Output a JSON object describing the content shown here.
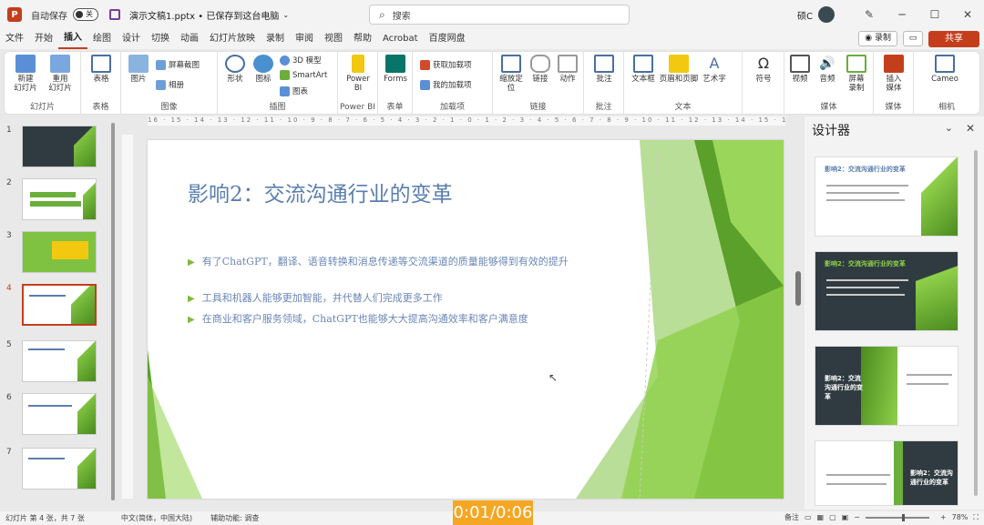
{
  "titlebar": {
    "autosave_label": "自动保存",
    "autosave_state": "关",
    "file_title": "演示文稿1.pptx • 已保存到这台电脑",
    "search_placeholder": "搜索",
    "user_name": "硕C"
  },
  "tabs": [
    "文件",
    "开始",
    "插入",
    "绘图",
    "设计",
    "切换",
    "动画",
    "幻灯片放映",
    "录制",
    "审阅",
    "视图",
    "帮助",
    "Acrobat",
    "百度网盘"
  ],
  "active_tab": "插入",
  "tab_actions": {
    "record": "◉ 录制",
    "share": "共享"
  },
  "ribbon": {
    "groups": [
      {
        "label": "幻灯片",
        "buttons": [
          "新建\n幻灯片",
          "重用\n幻灯片"
        ]
      },
      {
        "label": "表格",
        "buttons": [
          "表格"
        ]
      },
      {
        "label": "图像",
        "buttons": [
          "图片",
          "屏幕截图",
          "相册"
        ]
      },
      {
        "label": "插图",
        "buttons": [
          "形状",
          "图标",
          "3D 模型",
          "SmartArt",
          "图表"
        ]
      },
      {
        "label": "Power BI",
        "buttons": [
          "Power\nBI"
        ]
      },
      {
        "label": "表单",
        "buttons": [
          "Forms"
        ]
      },
      {
        "label": "加载项",
        "buttons": [
          "获取加载项",
          "我的加载项"
        ]
      },
      {
        "label": "链接",
        "buttons": [
          "缩放定\n位",
          "链接",
          "动作"
        ]
      },
      {
        "label": "批注",
        "buttons": [
          "批注"
        ]
      },
      {
        "label": "文本",
        "buttons": [
          "文本框",
          "页眉和页脚",
          "艺术字"
        ]
      },
      {
        "label": "",
        "buttons": [
          "符号"
        ]
      },
      {
        "label": "媒体",
        "buttons": [
          "视频",
          "音频",
          "屏幕\n录制"
        ]
      },
      {
        "label": "媒体",
        "buttons": [
          "插入\n媒体"
        ]
      },
      {
        "label": "相机",
        "buttons": [
          "Cameo"
        ]
      }
    ]
  },
  "ruler_text": "16 · 15 · 14 · 13 · 12 · 11 · 10 · 9 · 8 · 7 · 6 · 5 · 4 · 3 · 2 · 1 · 0 · 1 · 2 · 3 · 4 · 5 · 6 · 7 · 8 · 9 · 10 · 11 · 12 · 13 · 14 · 15 · 16",
  "thumbnails": [
    "1",
    "2",
    "3",
    "4",
    "5",
    "6",
    "7"
  ],
  "selected_slide": "4",
  "slide": {
    "title": "影响2：交流沟通行业的变革",
    "bullets": [
      "有了ChatGPT，翻译、语音转换和消息传递等交流渠道的质量能够得到有效的提升",
      "工具和机器人能够更加智能，并代替人们完成更多工作",
      "在商业和客户服务领域，ChatGPT也能够大大提高沟通效率和客户满意度"
    ]
  },
  "designer": {
    "title": "设计器",
    "cards": [
      {
        "title": "影响2：交流沟通行业的变革",
        "theme": "white"
      },
      {
        "title": "影响2：交流沟通行业的变革",
        "theme": "dark"
      },
      {
        "title": "影响2：交流沟通行业的变革",
        "theme": "dark-green"
      },
      {
        "title": "影响2：交流沟通行业的变革",
        "theme": "white-dark"
      }
    ]
  },
  "statusbar": {
    "slide_count": "幻灯片 第 4 张，共 7 张",
    "language": "中文(简体，中国大陆)",
    "accessibility": "辅助功能: 调查",
    "notes": "备注",
    "zoom": "78%"
  },
  "timer": "0:01/0:06",
  "colors": {
    "accent": "#c43e1c",
    "slide_green": "#7fba3e",
    "title_blue": "#5a7eb0",
    "timer_bg": "#f5a623"
  }
}
